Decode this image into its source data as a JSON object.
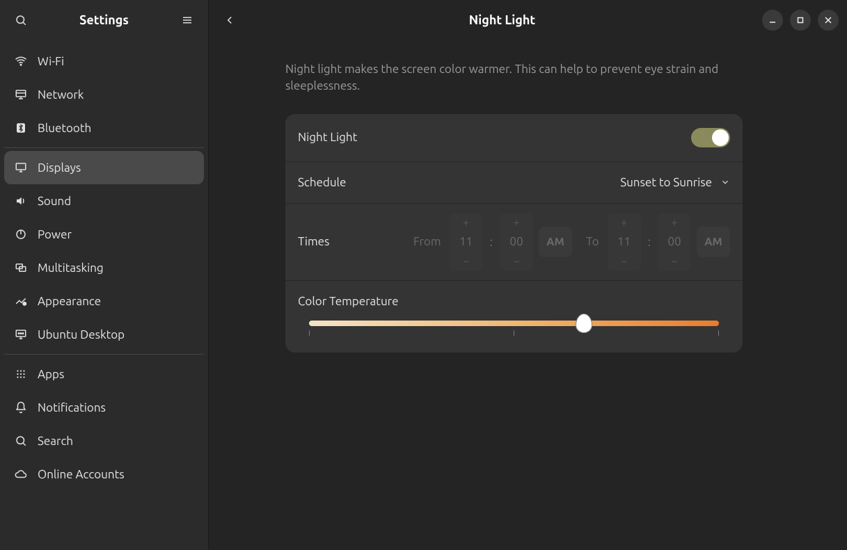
{
  "sidebar": {
    "title": "Settings",
    "items": [
      {
        "label": "Wi-Fi",
        "icon": "wifi"
      },
      {
        "label": "Network",
        "icon": "network"
      },
      {
        "label": "Bluetooth",
        "icon": "bluetooth"
      },
      {
        "sep": true
      },
      {
        "label": "Displays",
        "icon": "display",
        "selected": true
      },
      {
        "label": "Sound",
        "icon": "sound"
      },
      {
        "label": "Power",
        "icon": "power"
      },
      {
        "label": "Multitasking",
        "icon": "multitask"
      },
      {
        "label": "Appearance",
        "icon": "appearance"
      },
      {
        "label": "Ubuntu Desktop",
        "icon": "ubuntu"
      },
      {
        "sep": true
      },
      {
        "label": "Apps",
        "icon": "apps"
      },
      {
        "label": "Notifications",
        "icon": "bell"
      },
      {
        "label": "Search",
        "icon": "search"
      },
      {
        "label": "Online Accounts",
        "icon": "cloud"
      }
    ]
  },
  "header": {
    "title": "Night Light"
  },
  "description": "Night light makes the screen color warmer. This can help to prevent eye strain and sleeplessness.",
  "nightlight": {
    "label": "Night Light",
    "enabled": true
  },
  "schedule": {
    "label": "Schedule",
    "value": "Sunset to Sunrise"
  },
  "times": {
    "label": "Times",
    "from_label": "From",
    "from_hour": "11",
    "from_min": "00",
    "from_ampm": "AM",
    "to_label": "To",
    "to_hour": "11",
    "to_min": "00",
    "to_ampm": "AM",
    "disabled": true
  },
  "colortemp": {
    "label": "Color Temperature",
    "slider_percent": 67
  }
}
